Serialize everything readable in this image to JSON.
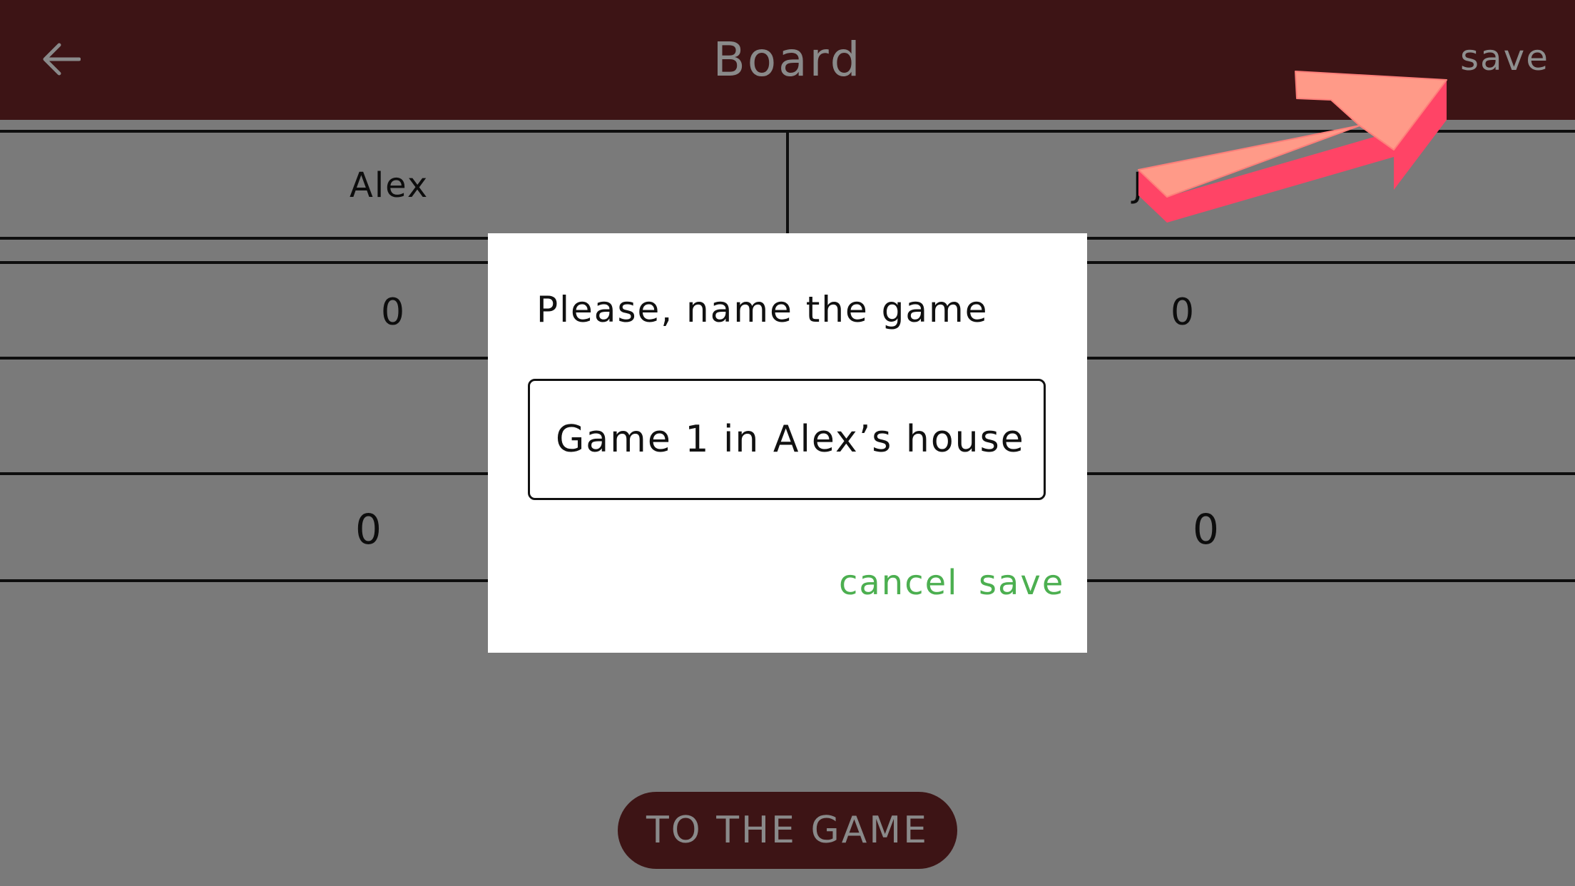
{
  "appbar": {
    "back_icon": "arrow-left-icon",
    "title": "Board",
    "save_label": "save"
  },
  "board": {
    "players": [
      "Alex",
      "J"
    ],
    "round_scores": [
      "0",
      "0"
    ],
    "totals": [
      "0",
      "0"
    ]
  },
  "footer": {
    "to_game_label": "TO THE GAME"
  },
  "dialog": {
    "title": "Please, name the game",
    "input_value": "Game 1 in Alex’s house",
    "cancel_label": "cancel",
    "save_label": "save"
  },
  "annotation": {
    "pointer_icon": "pointer-arrow-icon",
    "color": "#ff4466"
  },
  "colors": {
    "appbar_bg": "#3d1415",
    "overlay_gray": "#7a7a7a",
    "action_green": "#4caf50"
  }
}
